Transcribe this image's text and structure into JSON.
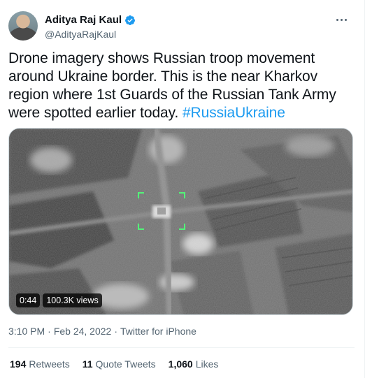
{
  "author": {
    "display_name": "Aditya Raj Kaul",
    "handle": "@AdityaRajKaul"
  },
  "tweet": {
    "text": "Drone imagery shows Russian troop movement around Ukraine border. This is the near Kharkov region where 1st Guards of the Russian Tank Army were spotted earlier today.",
    "hashtag": "#RussiaUkraine"
  },
  "media": {
    "duration": "0:44",
    "views": "100.3K views"
  },
  "meta": {
    "time": "3:10 PM",
    "separator": "·",
    "date": "Feb 24, 2022",
    "source": "Twitter for iPhone"
  },
  "stats": {
    "retweets_count": "194",
    "retweets_label": "Retweets",
    "quotes_count": "11",
    "quotes_label": "Quote Tweets",
    "likes_count": "1,060",
    "likes_label": "Likes"
  },
  "colors": {
    "link": "#1d9bf0",
    "verified": "#1d9bf0",
    "secondary_text": "#536471"
  },
  "icons": [
    "verified-badge-icon",
    "more-options-icon"
  ]
}
